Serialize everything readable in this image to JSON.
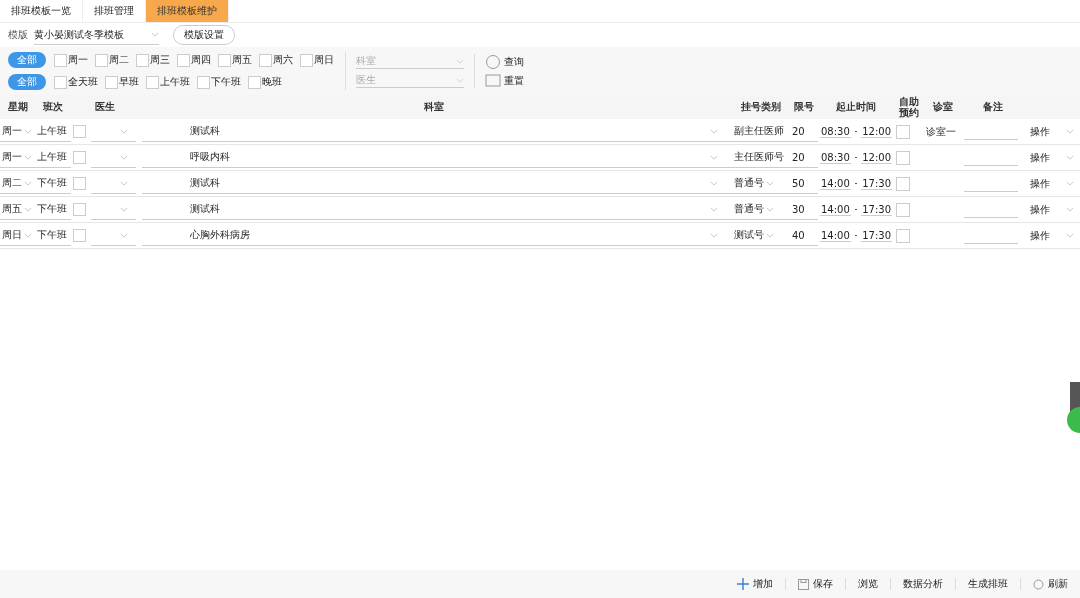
{
  "tabs": [
    {
      "label": "排班模板一览",
      "selected": false
    },
    {
      "label": "排班管理",
      "selected": false
    },
    {
      "label": "排班模板维护",
      "selected": true
    }
  ],
  "template": {
    "label": "模版",
    "value": "黄小晏测试冬季模板",
    "settings_button": "模版设置"
  },
  "day_filter": {
    "all_button": "全部",
    "options": [
      {
        "label": "周一",
        "checked": false
      },
      {
        "label": "周二",
        "checked": false
      },
      {
        "label": "周三",
        "checked": false
      },
      {
        "label": "周四",
        "checked": false
      },
      {
        "label": "周五",
        "checked": false
      },
      {
        "label": "周六",
        "checked": false
      },
      {
        "label": "周日",
        "checked": false
      }
    ]
  },
  "shift_filter": {
    "all_button": "全部",
    "options": [
      {
        "label": "全天班",
        "checked": false
      },
      {
        "label": "早班",
        "checked": false
      },
      {
        "label": "上午班",
        "checked": false
      },
      {
        "label": "下午班",
        "checked": false
      },
      {
        "label": "晚班",
        "checked": false
      }
    ]
  },
  "department_select": {
    "placeholder": "科室"
  },
  "doctor_select": {
    "placeholder": "医生"
  },
  "query_button": "查询",
  "reset_button": "重置",
  "table": {
    "columns": [
      "星期",
      "班次",
      "医生",
      "科室",
      "挂号类别",
      "限号",
      "起止时间",
      "自助预约",
      "诊室",
      "备注"
    ],
    "rows": [
      {
        "weekday": "周一",
        "shift": "上午班",
        "doctor_checked": false,
        "department": "测试科",
        "registration_type": "副主任医师",
        "type_caret": false,
        "limit": "20",
        "start": "08:30",
        "end": "12:00",
        "self_booking": false,
        "room": "诊室一",
        "action": "操作"
      },
      {
        "weekday": "周一",
        "shift": "上午班",
        "doctor_checked": false,
        "department": "呼吸内科",
        "registration_type": "主任医师号",
        "type_caret": false,
        "limit": "20",
        "start": "08:30",
        "end": "12:00",
        "self_booking": false,
        "action": "操作"
      },
      {
        "weekday": "周二",
        "shift": "下午班",
        "doctor_checked": false,
        "department": "测试科",
        "registration_type": "普通号",
        "type_caret": true,
        "limit": "50",
        "start": "14:00",
        "end": "17:30",
        "self_booking": false,
        "action": "操作"
      },
      {
        "weekday": "周五",
        "shift": "下午班",
        "doctor_checked": false,
        "department": "测试科",
        "registration_type": "普通号",
        "type_caret": true,
        "limit": "30",
        "start": "14:00",
        "end": "17:30",
        "self_booking": false,
        "action": "操作"
      },
      {
        "weekday": "周日",
        "shift": "下午班",
        "doctor_checked": false,
        "department": "心胸外科病房",
        "registration_type": "测试号",
        "type_caret": true,
        "limit": "40",
        "start": "14:00",
        "end": "17:30",
        "self_booking": false,
        "action": "操作"
      }
    ]
  },
  "toolbar": [
    {
      "label": "增加",
      "kind": "add"
    },
    {
      "label": "保存",
      "kind": "save"
    },
    {
      "label": "浏览",
      "kind": "plain"
    },
    {
      "label": "数据分析",
      "kind": "plain"
    },
    {
      "label": "生成排班",
      "kind": "plain"
    },
    {
      "label": "刷新",
      "kind": "refresh"
    }
  ]
}
